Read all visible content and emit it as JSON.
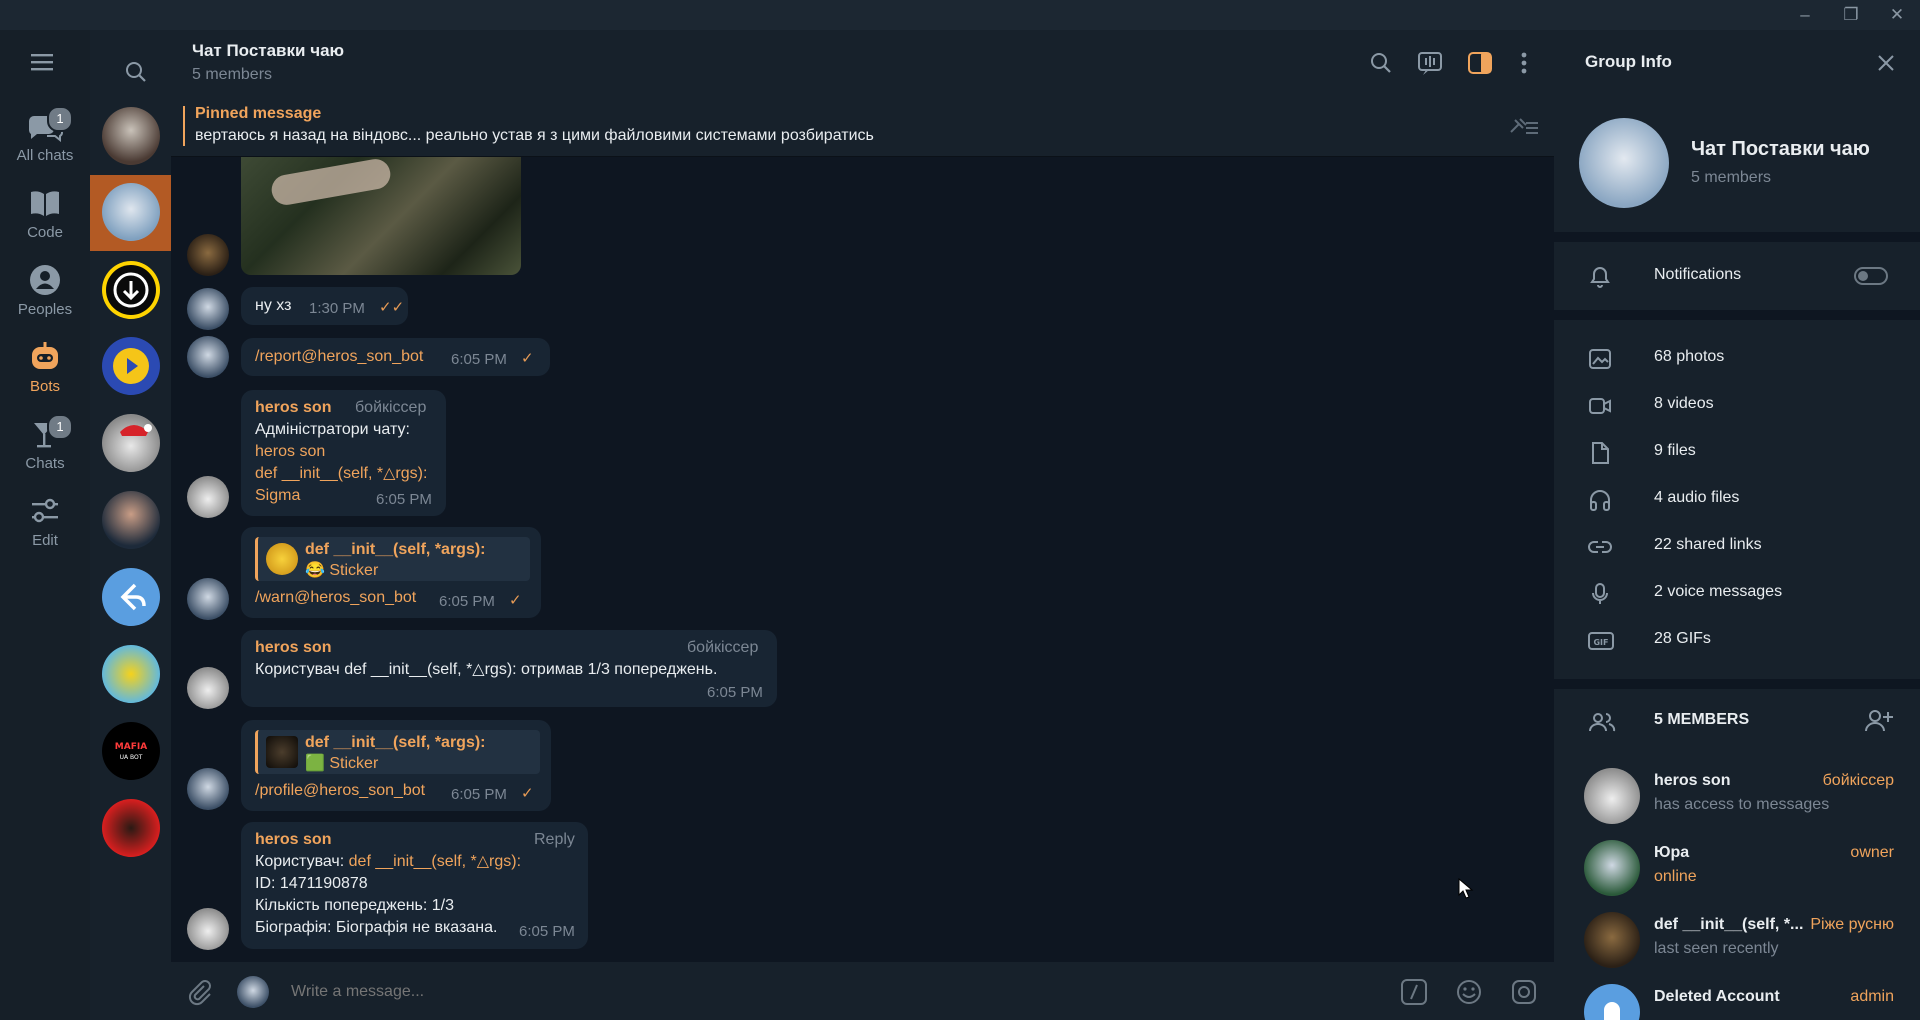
{
  "colors": {
    "accent": "#f0a45c",
    "bg": "#0e1621",
    "panel": "#17212b",
    "bubble": "#182533",
    "active_folder_bg": "#b35a24"
  },
  "folders": [
    {
      "label": "All chats",
      "icon": "chat-bubbles-icon",
      "badge": "1"
    },
    {
      "label": "Code",
      "icon": "book-icon",
      "badge": ""
    },
    {
      "label": "Peoples",
      "icon": "person-icon",
      "badge": ""
    },
    {
      "label": "Bots",
      "icon": "bot-icon",
      "badge": ""
    },
    {
      "label": "Chats",
      "icon": "cocktail-icon",
      "badge": "1"
    },
    {
      "label": "Edit",
      "icon": "sliders-icon",
      "badge": ""
    }
  ],
  "chat": {
    "title": "Чат Поставки чаю",
    "subtitle": "5 members",
    "pinned_label": "Pinned message",
    "pinned_text": "вертаюсь я назад на віндовс... реально устав я з цими файловими системами розбиратись",
    "composer_placeholder": "Write a message..."
  },
  "messages": {
    "m1": {
      "text": "ну хз",
      "time": "1:30 PM"
    },
    "m2": {
      "text": "/report@heros_son_bot",
      "time": "6:05 PM"
    },
    "m3": {
      "name": "heros son",
      "role": "бойкіссер",
      "line1": "Адміністратори чату:",
      "line2": "heros son",
      "line3": "def __init__(self, *△rgs):",
      "line4": "Sigma",
      "time": "6:05 PM"
    },
    "m4": {
      "reply_name": "def __init__(self, *args):",
      "reply_text": "😂 Sticker",
      "text": "/warn@heros_son_bot",
      "time": "6:05 PM"
    },
    "m5": {
      "name": "heros son",
      "role": "бойкіссер",
      "text": "Користувач def __init__(self, *△rgs): отримав 1/3 попереджень.",
      "time": "6:05 PM"
    },
    "m6": {
      "reply_name": "def __init__(self, *args):",
      "reply_text": "🟩 Sticker",
      "text": "/profile@heros_son_bot",
      "time": "6:05 PM"
    },
    "m7": {
      "name": "heros son",
      "role": "Reply",
      "l1a": "Користувач: ",
      "l1b": "def __init__(self, *△rgs):",
      "l2": "ID: 1471190878",
      "l3": "Кількість попереджень: 1/3",
      "l4": "Біографія: Біографія не вказана.",
      "time": "6:05 PM"
    }
  },
  "info": {
    "title": "Group Info",
    "name": "Чат Поставки чаю",
    "members_count": "5 members",
    "notifications": "Notifications",
    "notifications_on": false,
    "media": [
      {
        "label": "68 photos",
        "icon": "photo-icon"
      },
      {
        "label": "8 videos",
        "icon": "video-icon"
      },
      {
        "label": "9 files",
        "icon": "file-icon"
      },
      {
        "label": "4 audio files",
        "icon": "headphones-icon"
      },
      {
        "label": "22 shared links",
        "icon": "link-icon"
      },
      {
        "label": "2 voice messages",
        "icon": "mic-icon"
      },
      {
        "label": "28 GIFs",
        "icon": "gif-icon"
      }
    ],
    "members_header": "5 MEMBERS",
    "members": [
      {
        "name": "heros son",
        "status": "has access to messages",
        "role": "бойкіссер"
      },
      {
        "name": "Юра",
        "status": "online",
        "role": "owner"
      },
      {
        "name": "def __init__(self, *...",
        "status": "last seen recently",
        "role": "Ріже русню"
      },
      {
        "name": "Deleted Account",
        "status": "",
        "role": "admin"
      }
    ]
  }
}
